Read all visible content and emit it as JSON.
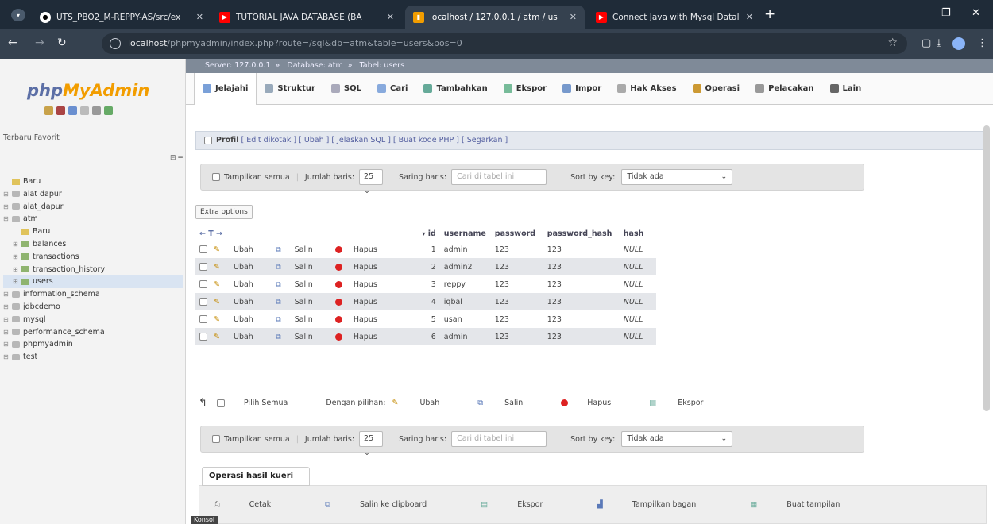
{
  "browser": {
    "tabs": [
      {
        "title": "UTS_PBO2_M-REPPY-AS/src/ex",
        "icon": "github-icon",
        "color": "#ffffff"
      },
      {
        "title": "TUTORIAL JAVA DATABASE (BA",
        "icon": "youtube-icon",
        "color": "#ff0000"
      },
      {
        "title": "localhost / 127.0.0.1 / atm / us",
        "icon": "phpmyadmin-icon",
        "color": "#f29d00"
      },
      {
        "title": "Connect Java with Mysql Datal",
        "icon": "youtube-icon",
        "color": "#ff0000"
      }
    ],
    "url_host": "localhost",
    "url_path": "/phpmyadmin/index.php?route=/sql&db=atm&table=users&pos=0"
  },
  "sidebar": {
    "logo_php": "php",
    "logo_myadmin": "MyAdmin",
    "tabs": "Terbaru  Favorit",
    "tree": [
      {
        "label": "Baru",
        "level": 0,
        "kind": "new"
      },
      {
        "label": "alat dapur",
        "level": 0,
        "kind": "db"
      },
      {
        "label": "alat_dapur",
        "level": 0,
        "kind": "db"
      },
      {
        "label": "atm",
        "level": 0,
        "kind": "db"
      },
      {
        "label": "Baru",
        "level": 1,
        "kind": "new"
      },
      {
        "label": "balances",
        "level": 1,
        "kind": "tbl"
      },
      {
        "label": "transactions",
        "level": 1,
        "kind": "tbl"
      },
      {
        "label": "transaction_history",
        "level": 1,
        "kind": "tbl"
      },
      {
        "label": "users",
        "level": 1,
        "kind": "tbl"
      },
      {
        "label": "information_schema",
        "level": 0,
        "kind": "db"
      },
      {
        "label": "jdbcdemo",
        "level": 0,
        "kind": "db"
      },
      {
        "label": "mysql",
        "level": 0,
        "kind": "db"
      },
      {
        "label": "performance_schema",
        "level": 0,
        "kind": "db"
      },
      {
        "label": "phpmyadmin",
        "level": 0,
        "kind": "db"
      },
      {
        "label": "test",
        "level": 0,
        "kind": "db"
      }
    ]
  },
  "breadcrumb": {
    "server": "Server: 127.0.0.1",
    "database": "Database: atm",
    "table": "Tabel: users"
  },
  "menu": [
    {
      "label": "Jelajahi",
      "color": "#7aa0d8"
    },
    {
      "label": "Struktur",
      "color": "#9ab"
    },
    {
      "label": "SQL",
      "color": "#aab"
    },
    {
      "label": "Cari",
      "color": "#8ad"
    },
    {
      "label": "Tambahkan",
      "color": "#6a9"
    },
    {
      "label": "Ekspor",
      "color": "#7b9"
    },
    {
      "label": "Impor",
      "color": "#79c"
    },
    {
      "label": "Hak Akses",
      "color": "#aaa"
    },
    {
      "label": "Operasi",
      "color": "#c93"
    },
    {
      "label": "Pelacakan",
      "color": "#999"
    },
    {
      "label": "Lain",
      "color": "#666"
    }
  ],
  "profil": {
    "label": "Profil",
    "links": "[ Edit dikotak ] [ Ubah ] [ Jelaskan SQL ] [ Buat kode PHP ] [ Segarkan ]"
  },
  "navbar": {
    "show_all": "Tampilkan semua",
    "rows_label": "Jumlah baris:",
    "rows_value": "25",
    "filter_label": "Saring baris:",
    "filter_placeholder": "Cari di tabel ini",
    "sort_label": "Sort by key:",
    "sort_value": "Tidak ada"
  },
  "extra_options": "Extra options",
  "table": {
    "headers": [
      "id",
      "username",
      "password",
      "password_hash",
      "hash"
    ],
    "actions": {
      "edit": "Ubah",
      "copy": "Salin",
      "delete": "Hapus"
    },
    "rows": [
      {
        "id": "1",
        "username": "admin",
        "password": "123",
        "password_hash": "123",
        "hash": "NULL"
      },
      {
        "id": "2",
        "username": "admin2",
        "password": "123",
        "password_hash": "123",
        "hash": "NULL"
      },
      {
        "id": "3",
        "username": "reppy",
        "password": "123",
        "password_hash": "123",
        "hash": "NULL"
      },
      {
        "id": "4",
        "username": "iqbal",
        "password": "123",
        "password_hash": "123",
        "hash": "NULL"
      },
      {
        "id": "5",
        "username": "usan",
        "password": "123",
        "password_hash": "123",
        "hash": "NULL"
      },
      {
        "id": "6",
        "username": "admin",
        "password": "123",
        "password_hash": "123",
        "hash": "NULL"
      }
    ]
  },
  "bulk": {
    "select_all": "Pilih Semua",
    "with_selected": "Dengan pilihan:",
    "edit": "Ubah",
    "copy": "Salin",
    "delete": "Hapus",
    "export": "Ekspor"
  },
  "query_ops": {
    "title": "Operasi hasil kueri",
    "print": "Cetak",
    "copy_clipboard": "Salin ke clipboard",
    "export": "Ekspor",
    "chart": "Tampilkan bagan",
    "create_view": "Buat tampilan"
  },
  "konsol": "Konsol"
}
